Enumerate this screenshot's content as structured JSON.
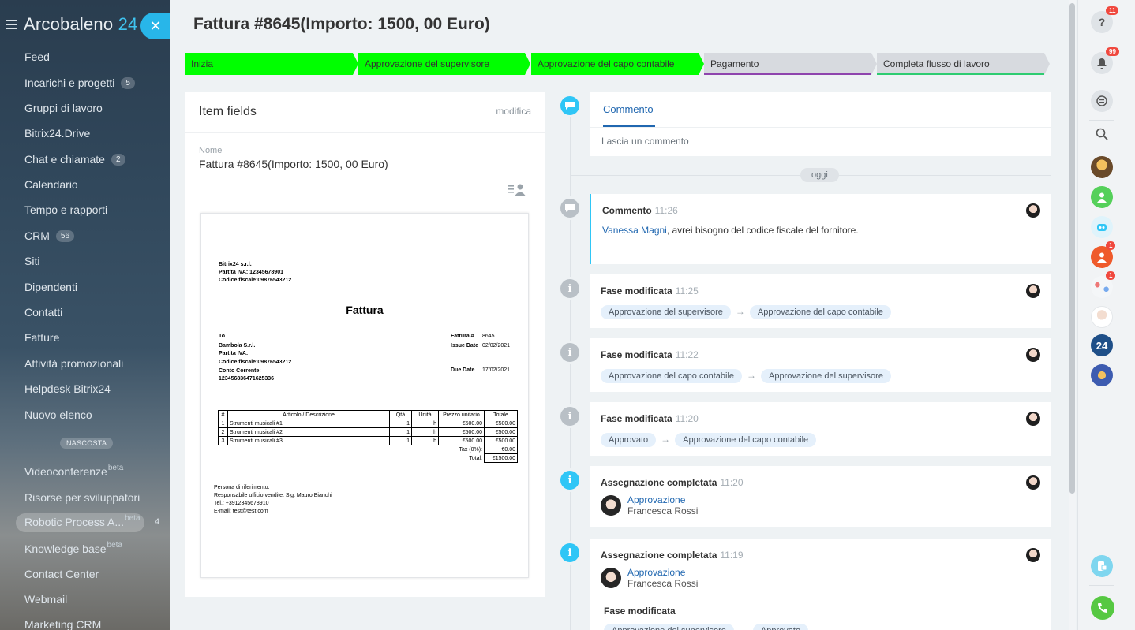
{
  "sidebar": {
    "brand_main": "Arcobaleno",
    "brand_num": "24",
    "close_glyph": "✕",
    "items": [
      {
        "label": "Feed",
        "count": ""
      },
      {
        "label": "Incarichi e progetti",
        "count": "5"
      },
      {
        "label": "Gruppi di lavoro",
        "count": ""
      },
      {
        "label": "Bitrix24.Drive",
        "count": ""
      },
      {
        "label": "Chat e chiamate",
        "count": "2"
      },
      {
        "label": "Calendario",
        "count": ""
      },
      {
        "label": "Tempo e rapporti",
        "count": ""
      },
      {
        "label": "CRM",
        "count": "56"
      },
      {
        "label": "Siti",
        "count": ""
      },
      {
        "label": "Dipendenti",
        "count": ""
      },
      {
        "label": "Contatti",
        "count": ""
      },
      {
        "label": "Fatture",
        "count": ""
      },
      {
        "label": "Attività promozionali",
        "count": ""
      },
      {
        "label": "Helpdesk Bitrix24",
        "count": ""
      },
      {
        "label": "Nuovo elenco",
        "count": ""
      }
    ],
    "hidden_label": "NASCOSTA",
    "hidden_items": [
      {
        "label": "Videoconferenze",
        "sup": "beta"
      },
      {
        "label": "Risorse per sviluppatori",
        "sup": ""
      },
      {
        "label": "Robotic Process A...",
        "sup": "beta"
      },
      {
        "label": "Knowledge base",
        "sup": "beta"
      },
      {
        "label": "Contact Center",
        "sup": ""
      },
      {
        "label": "Webmail",
        "sup": ""
      },
      {
        "label": "Marketing CRM",
        "sup": ""
      }
    ],
    "active_count": "4"
  },
  "page": {
    "title": "Fattura #8645(Importo: 1500, 00 Euro)"
  },
  "stages": [
    {
      "label": "Inizia",
      "state": "done",
      "line": ""
    },
    {
      "label": "Approvazione del supervisore",
      "state": "done",
      "line": ""
    },
    {
      "label": "Approvazione del capo contabile",
      "state": "done",
      "line": ""
    },
    {
      "label": "Pagamento",
      "state": "todo",
      "line": "#8e44ad"
    },
    {
      "label": "Completa flusso di lavoro",
      "state": "todo",
      "line": "#2ecc71"
    }
  ],
  "fields": {
    "header": "Item fields",
    "edit": "modifica",
    "name_label": "Nome",
    "name_value": "Fattura #8645(Importo: 1500, 00 Euro)"
  },
  "invoice": {
    "company": "Bitrix24 s.r.l.",
    "vat": "Partita IVA: 12345678901",
    "fiscal": "Codice fiscale:09876543212",
    "title": "Fattura",
    "to_label": "To",
    "to_company": "Bambola S.r.l.",
    "to_vat": "Partita IVA:",
    "to_fiscal": "Codice fiscale:09876543212",
    "to_account_label": "Conto Corrente:",
    "to_account": "123456836471625336",
    "num_label": "Fattura #",
    "num_value": "8645",
    "issue_label": "Issue Date",
    "issue_value": "02/02/2021",
    "due_label": "Due Date",
    "due_value": "17/02/2021",
    "headers": [
      "#",
      "Articolo / Descrizione",
      "Qtà",
      "Unità",
      "Prezzo unitario",
      "Totale"
    ],
    "rows": [
      [
        "1",
        "Strumenti musicali #1",
        "1",
        "h",
        "€500.00",
        "€500.00"
      ],
      [
        "2",
        "Strumenti musicali #2",
        "1",
        "h",
        "€500.00",
        "€500.00"
      ],
      [
        "3",
        "Strumenti musicali #3",
        "1",
        "h",
        "€500.00",
        "€500.00"
      ]
    ],
    "tax_label": "Tax (0%):",
    "tax_value": "€0.00",
    "total_label": "Total:",
    "total_value": "€1500.00",
    "ref_title": "Persona di riferimento:",
    "ref_manager": "Responsabile ufficio vendite: Sig. Mauro Bianchi",
    "ref_tel": "Tel.: +3912345678910",
    "ref_email": "E-mail: test@test.com"
  },
  "comment_box": {
    "tab": "Commento",
    "placeholder": "Lascia un commento"
  },
  "today_label": "oggi",
  "timeline": {
    "comment": {
      "title": "Commento",
      "time": "11:26",
      "author": "Vanessa Magni",
      "text": ", avrei bisogno del codice fiscale del fornitore."
    },
    "stage1": {
      "title": "Fase modificata",
      "time": "11:25",
      "from": "Approvazione del supervisore",
      "to": "Approvazione del capo contabile"
    },
    "stage2": {
      "title": "Fase modificata",
      "time": "11:22",
      "from": "Approvazione del capo contabile",
      "to": "Approvazione del supervisore"
    },
    "stage3": {
      "title": "Fase modificata",
      "time": "11:20",
      "from": "Approvato",
      "to": "Approvazione del capo contabile"
    },
    "assign1": {
      "title": "Assegnazione completata",
      "time": "11:20",
      "role": "Approvazione",
      "person": "Francesca Rossi"
    },
    "assign2": {
      "title": "Assegnazione completata",
      "time": "11:19",
      "role": "Approvazione",
      "person": "Francesca Rossi",
      "sub_title": "Fase modificata",
      "sub_from": "Approvazione del supervisore",
      "sub_to": "Approvato"
    }
  },
  "rightbar": {
    "help_badge": "11",
    "bell_badge": "99",
    "badge_a": "1",
    "badge_b": "1",
    "logo_24": "24"
  },
  "colors": {
    "accent": "#2fc6f6",
    "stage_done": "#00ff00",
    "link": "#2067b0"
  }
}
